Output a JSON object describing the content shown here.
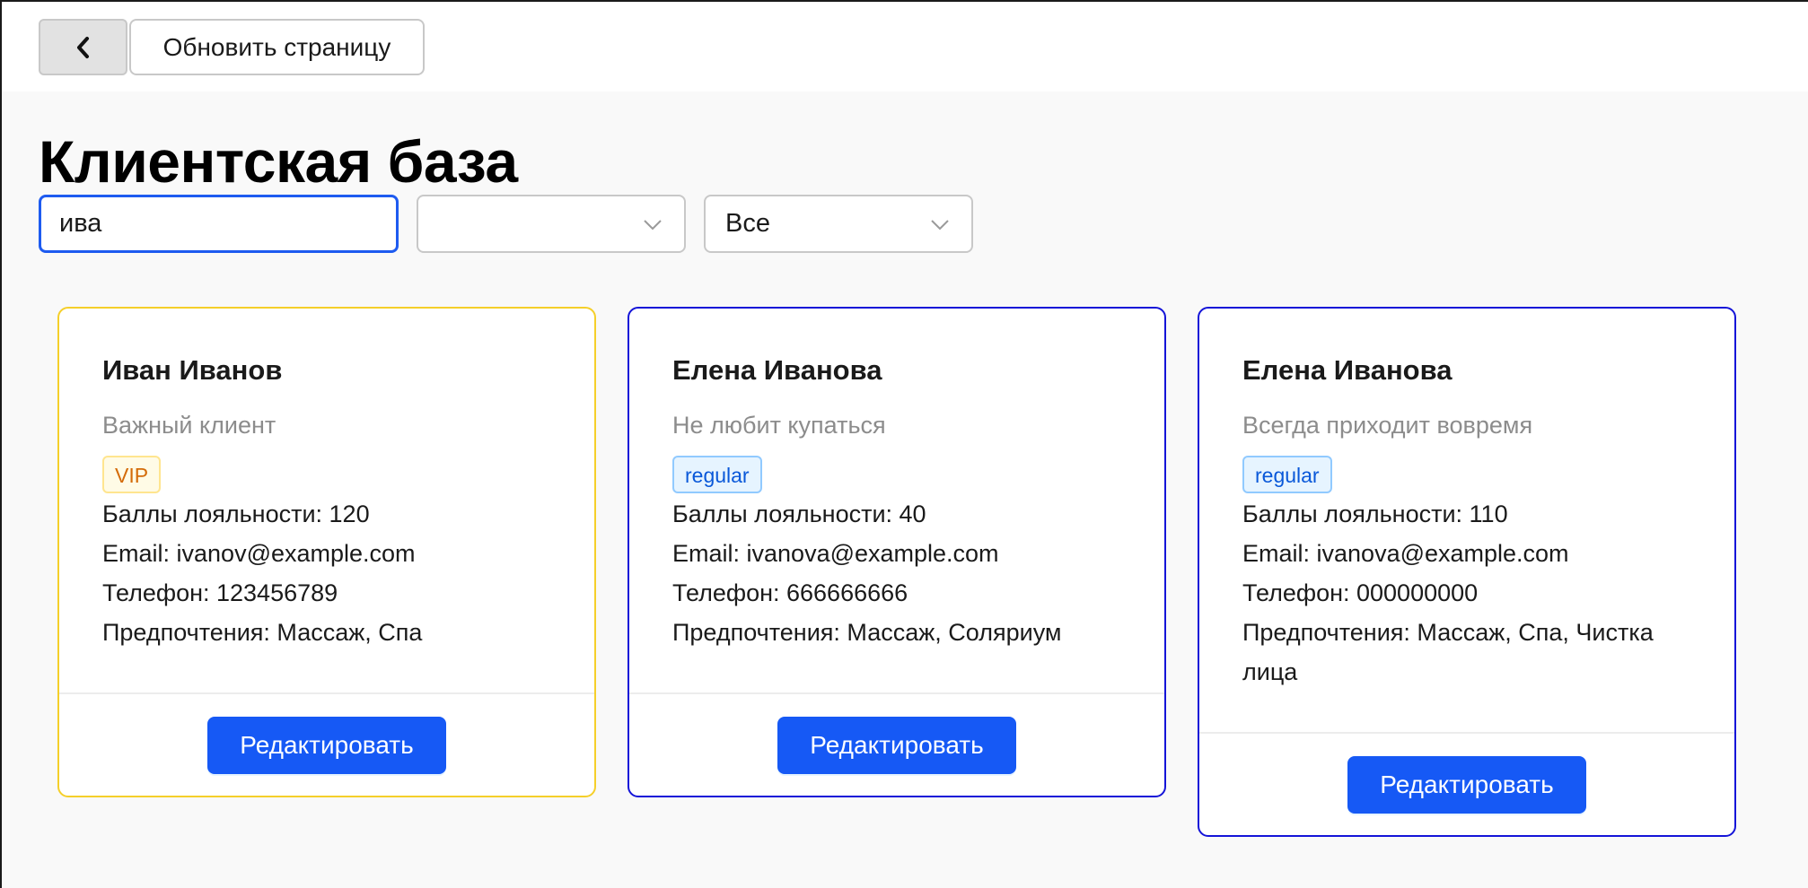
{
  "toolbar": {
    "back_icon": "chevron-left-icon",
    "refresh_label": "Обновить страницу"
  },
  "page": {
    "title": "Клиентская база"
  },
  "filters": {
    "search_value": "ива",
    "select1_value": "",
    "select2_value": "Все"
  },
  "clients": [
    {
      "name": "Иван Иванов",
      "note": "Важный клиент",
      "tag": "VIP",
      "loyalty": "Баллы лояльности: 120",
      "email": "Email: ivanov@example.com",
      "phone": "Телефон: 123456789",
      "prefs": "Предпочтения: Массаж, Спа",
      "edit_label": "Редактировать",
      "border_color": "#f5cf2a"
    },
    {
      "name": "Елена Иванова",
      "note": "Не любит купаться",
      "tag": "regular",
      "loyalty": "Баллы лояльности: 40",
      "email": "Email: ivanova@example.com",
      "phone": "Телефон: 666666666",
      "prefs": "Предпочтения: Массаж, Соляриум",
      "edit_label": "Редактировать",
      "border_color": "#1414d8"
    },
    {
      "name": "Елена Иванова",
      "note": "Всегда приходит вовремя",
      "tag": "regular",
      "loyalty": "Баллы лояльности: 110",
      "email": "Email: ivanova@example.com",
      "phone": "Телефон: 000000000",
      "prefs": "Предпочтения: Массаж, Спа, Чистка лица",
      "edit_label": "Редактировать",
      "border_color": "#1414d8"
    }
  ],
  "colors": {
    "primary": "#1659f5",
    "vip_border": "#f5cf2a",
    "regular_border": "#1414d8"
  }
}
